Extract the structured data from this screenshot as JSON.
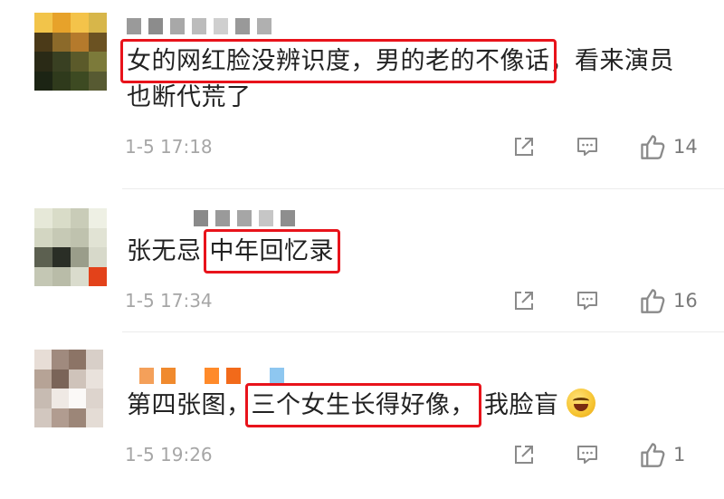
{
  "comments": [
    {
      "text_before": "",
      "highlight": "女的网红脸没辨识度，男的老的不像话",
      "text_after": "，看来演员也断代荒了",
      "timestamp": "1-5 17:18",
      "likes": "14",
      "colors": {
        "avatar": [
          "#f2c44a",
          "#e7a22a",
          "#f4c34a",
          "#d7b64a",
          "#4b3a18",
          "#8c6a2a",
          "#b57a2c",
          "#6b5222",
          "#2a2a16",
          "#394022",
          "#5b5a2a",
          "#7c7a3a",
          "#1c2414",
          "#2f3a1c",
          "#3d4a22",
          "#575a32"
        ],
        "username": [
          "#9a9a9a",
          "#8c8c8c",
          "#a8a8a8",
          "#bcbcbc",
          "#cfcfcf",
          "#999999",
          "#b0b0b0"
        ]
      }
    },
    {
      "text_before": "张无忌",
      "highlight": "中年回忆录",
      "text_after": "",
      "timestamp": "1-5 17:34",
      "likes": "16",
      "colors": {
        "avatar": [
          "#e6e8d8",
          "#d9dcc8",
          "#c9ccb8",
          "#eef0e4",
          "#d3d6c2",
          "#c6c9b5",
          "#bfc2ae",
          "#e1e3d4",
          "#5c6050",
          "#2a2e26",
          "#9a9d8a",
          "#d7d9ca",
          "#c4c7b4",
          "#b9bca8",
          "#dadccd",
          "#e3421a"
        ],
        "username": [
          "#8a8a8a",
          "#9a9a9a",
          "#a6a6a6",
          "#c6c6c6",
          "#8e8e8e"
        ]
      }
    },
    {
      "text_before": "第四张图，",
      "highlight": "三个女生长得好像，",
      "text_after": "我脸盲",
      "timestamp": "1-5 19:26",
      "likes": "1",
      "colors": {
        "avatar": [
          "#e7ddd6",
          "#a08a7e",
          "#8c7466",
          "#d8cfc8",
          "#b6a396",
          "#7a6458",
          "#cfc3ba",
          "#e9e2dc",
          "#c7bbb2",
          "#efe9e4",
          "#fbf9f7",
          "#ddd4cd",
          "#d2c7bf",
          "#b19c90",
          "#9c8678",
          "#e4dcd5"
        ],
        "username": [
          "#f4a05a",
          "#f08a2e",
          "#ffffff",
          "#ff8a2a",
          "#f26a1a",
          "#ffffff",
          "#8ec7f0"
        ]
      }
    }
  ]
}
